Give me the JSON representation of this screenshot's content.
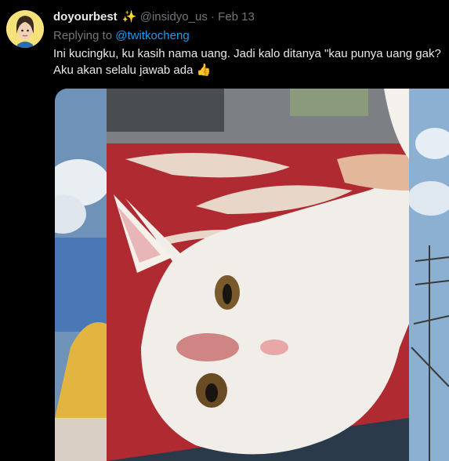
{
  "tweet": {
    "display_name": "doyourbest",
    "name_emoji": "✨",
    "handle": "@insidyo_us",
    "separator": "·",
    "date": "Feb 13",
    "replying_prefix": "Replying to",
    "replying_to": "@twitkocheng",
    "text_line1": "Ini kucingku, ku kasih nama uang. Jadi kalo ditanya \"kau punya uang gak?",
    "text_line2": "Aku akan selalu jawab ada",
    "text_emoji": "👍"
  },
  "icons": {
    "avatar": "cartoon-face-avatar",
    "sparkle": "sparkles-icon",
    "thumb": "thumbs-up-icon"
  },
  "colors": {
    "background": "#000000",
    "text": "#e7e9ea",
    "muted": "#71767b",
    "link": "#1d9bf0"
  }
}
